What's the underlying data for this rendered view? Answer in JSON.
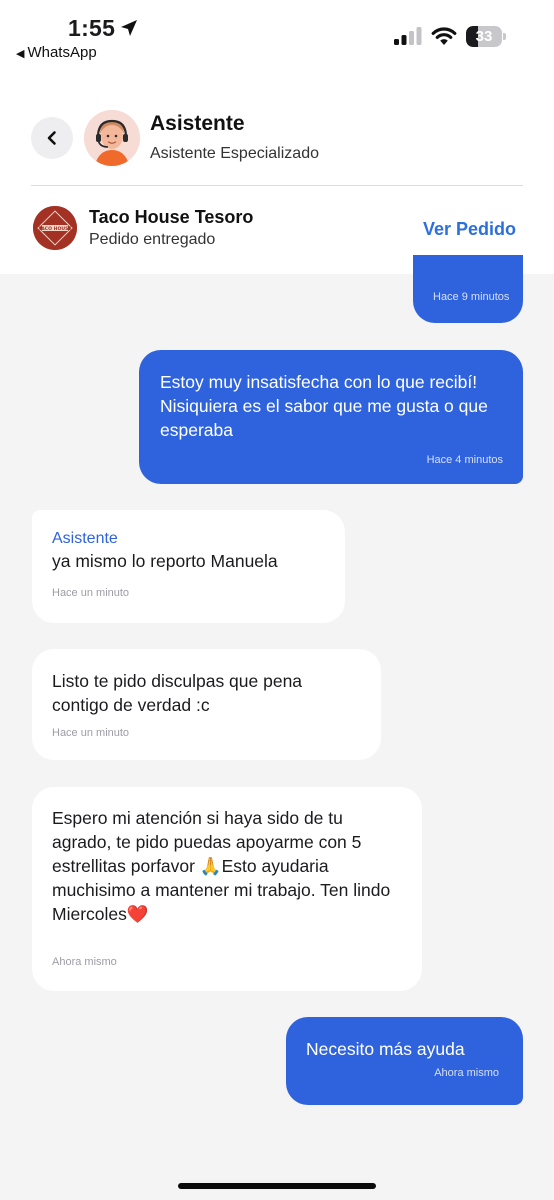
{
  "status_bar": {
    "time": "1:55",
    "back_app": "WhatsApp",
    "battery": "33",
    "battery_level": 0.33
  },
  "header": {
    "agent_name": "Asistente",
    "agent_role": "Asistente Especializado",
    "store_name": "Taco House Tesoro",
    "store_status": "Pedido entregado",
    "view_order": "Ver Pedido",
    "store_logo_text": "TACO HOUSE"
  },
  "messages": [
    {
      "direction": "out",
      "text": "",
      "time": "Hace 9 minutos"
    },
    {
      "direction": "out",
      "text": "Estoy muy insatisfecha con lo que recibí! Nisiquiera es el sabor que me gusta o que esperaba",
      "time": "Hace 4 minutos"
    },
    {
      "direction": "in",
      "sender": "Asistente",
      "text": "ya mismo lo reporto Manuela",
      "time": "Hace un minuto"
    },
    {
      "direction": "in",
      "text": "Listo te pido disculpas que pena contigo de verdad :c",
      "time": "Hace un minuto"
    },
    {
      "direction": "in",
      "text": "Espero mi atención si haya sido de tu agrado, te pido puedas apoyarme con 5 estrellitas porfavor 🙏Esto ayudaria muchisimo a mantener mi trabajo. Ten lindo Miercoles❤️",
      "time": "Ahora mismo"
    },
    {
      "direction": "out",
      "text": "Necesito más ayuda",
      "time": "Ahora mismo"
    }
  ],
  "colors": {
    "accent": "#2f63dd",
    "link": "#2d6fdb",
    "background": "#f4f4f5",
    "incoming_bubble": "#ffffff",
    "store_logo": "#a33224"
  },
  "icons": {
    "location": "location-arrow-icon",
    "signal": "cellular-signal-icon",
    "wifi": "wifi-icon",
    "battery": "battery-icon",
    "back": "chevron-left-icon"
  }
}
